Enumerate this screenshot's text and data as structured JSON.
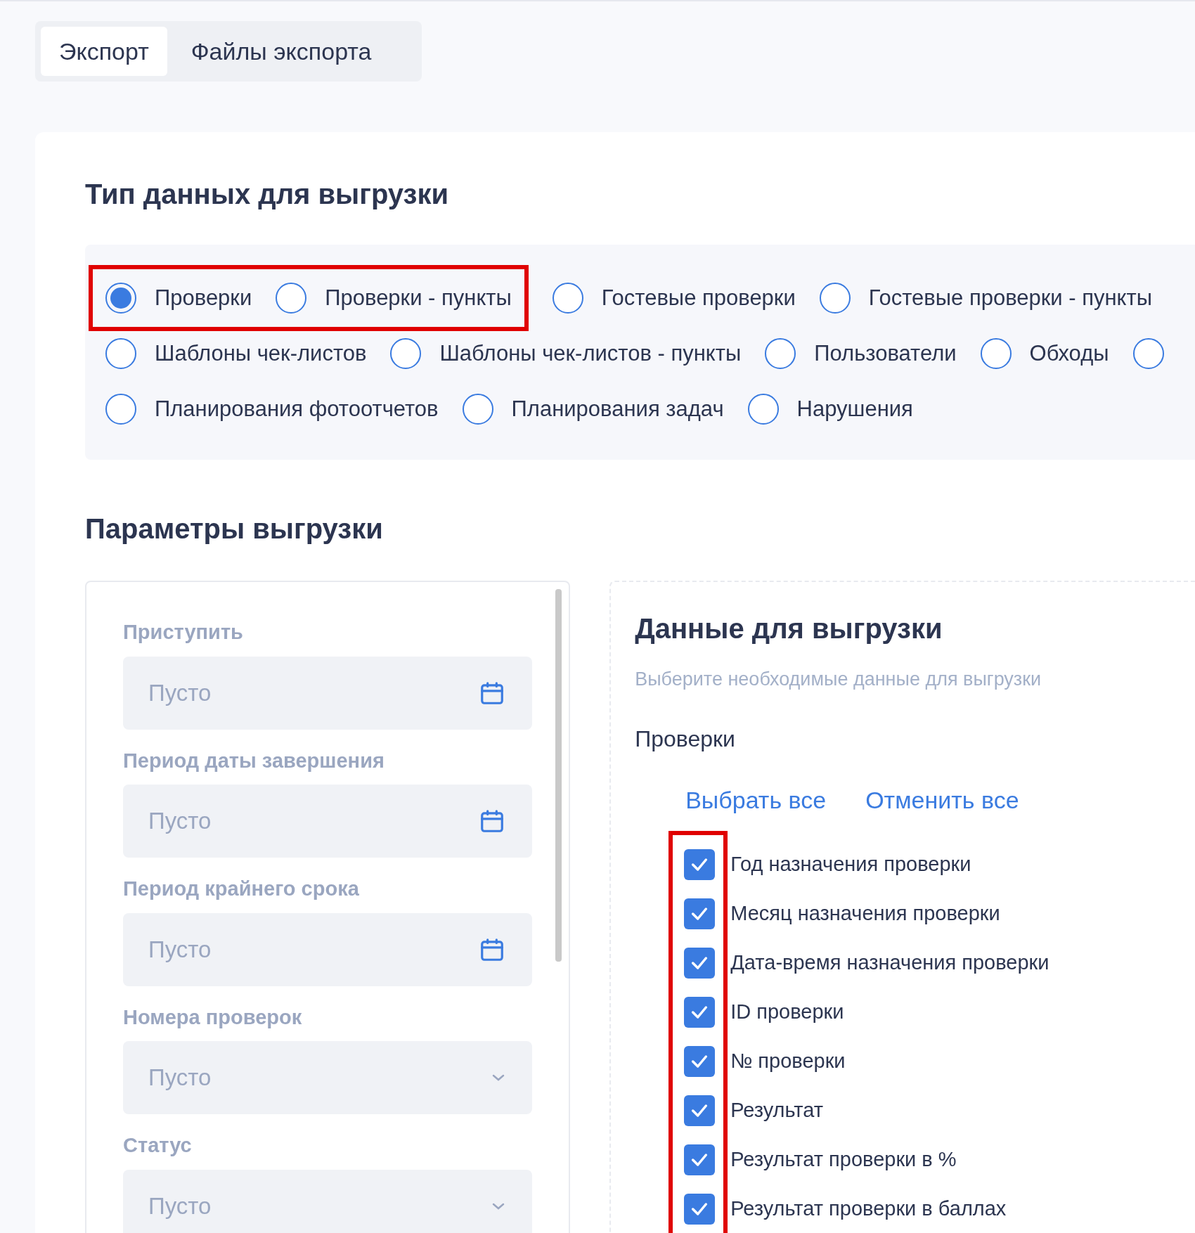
{
  "tabs": [
    {
      "label": "Экспорт",
      "selected": true
    },
    {
      "label": "Файлы экспорта",
      "selected": false
    }
  ],
  "data_type": {
    "title": "Тип данных для выгрузки",
    "rows": [
      {
        "options": [
          {
            "label": "Проверки",
            "selected": true,
            "highlighted": true
          },
          {
            "label": "Проверки - пункты",
            "selected": false,
            "highlighted": true
          },
          {
            "label": "Гостевые проверки",
            "selected": false,
            "highlighted": false
          },
          {
            "label": "Гостевые проверки - пункты",
            "selected": false,
            "highlighted": false
          }
        ]
      },
      {
        "options": [
          {
            "label": "Шаблоны чек-листов",
            "selected": false,
            "highlighted": false
          },
          {
            "label": "Шаблоны чек-листов - пункты",
            "selected": false,
            "highlighted": false
          },
          {
            "label": "Пользователи",
            "selected": false,
            "highlighted": false
          },
          {
            "label": "Обходы",
            "selected": false,
            "highlighted": false
          },
          {
            "selected": false,
            "highlighted": false
          }
        ]
      },
      {
        "options": [
          {
            "label": "Планирования фотоотчетов",
            "selected": false,
            "highlighted": false
          },
          {
            "label": "Планирования задач",
            "selected": false,
            "highlighted": false
          },
          {
            "label": "Нарушения",
            "selected": false,
            "highlighted": false
          }
        ]
      }
    ]
  },
  "params": {
    "title": "Параметры выгрузки",
    "filters": [
      {
        "label": "Приступить",
        "placeholder": "Пусто",
        "kind": "date"
      },
      {
        "label": "Период даты завершения",
        "placeholder": "Пусто",
        "kind": "date"
      },
      {
        "label": "Период крайнего срока",
        "placeholder": "Пусто",
        "kind": "date"
      },
      {
        "label": "Номера проверок",
        "placeholder": "Пусто",
        "kind": "select"
      },
      {
        "label": "Статус",
        "placeholder": "Пусто",
        "kind": "select"
      }
    ]
  },
  "data_fields": {
    "title": "Данные для выгрузки",
    "subtitle": "Выберите необходимые данные для выгрузки",
    "group": "Проверки",
    "select_all": "Выбрать все",
    "deselect_all": "Отменить все",
    "highlighted": true,
    "items": [
      {
        "label": "Год назначения проверки",
        "checked": true
      },
      {
        "label": "Месяц назначения проверки",
        "checked": true
      },
      {
        "label": "Дата-время назначения проверки",
        "checked": true
      },
      {
        "label": "ID проверки",
        "checked": true
      },
      {
        "label": "№ проверки",
        "checked": true
      },
      {
        "label": "Результат",
        "checked": true
      },
      {
        "label": "Результат проверки в %",
        "checked": true
      },
      {
        "label": "Результат проверки в баллах",
        "checked": true
      }
    ]
  }
}
